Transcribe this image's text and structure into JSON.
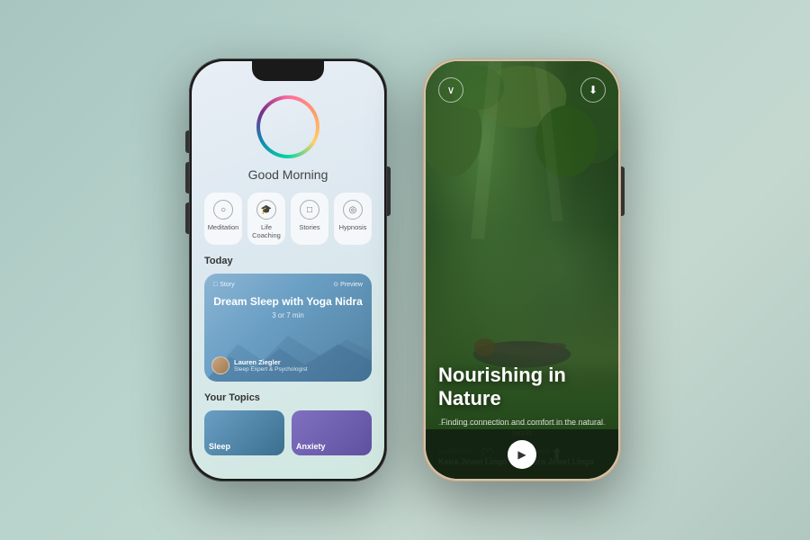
{
  "background": {
    "color": "#b8d0c8"
  },
  "left_phone": {
    "greeting": "Good Morning",
    "categories": [
      {
        "label": "Meditation",
        "icon": "○"
      },
      {
        "label": "Life Coaching",
        "icon": "🎓"
      },
      {
        "label": "Stories",
        "icon": "□"
      },
      {
        "label": "Hypnosis",
        "icon": "◎"
      }
    ],
    "today_label": "Today",
    "story_card": {
      "tag": "Story",
      "preview_label": "Preview",
      "title": "Dream Sleep with Yoga Nidra",
      "duration": "3 or 7 min",
      "author_name": "Lauren Ziegler",
      "author_title": "Sleep Expert & Psychologist"
    },
    "topics_label": "Your Topics",
    "topics": [
      {
        "label": "Sleep"
      },
      {
        "label": "Anxiety"
      }
    ]
  },
  "right_phone": {
    "title": "Nourishing in Nature",
    "subtitle": "Finding connection and comfort in the natural world",
    "narrator_role": "NARRATOR",
    "narrator_name": "Kaira Jewel Lingo",
    "author_role": "AUTHOR",
    "author_name": "Kaira Jewel Lingo"
  }
}
